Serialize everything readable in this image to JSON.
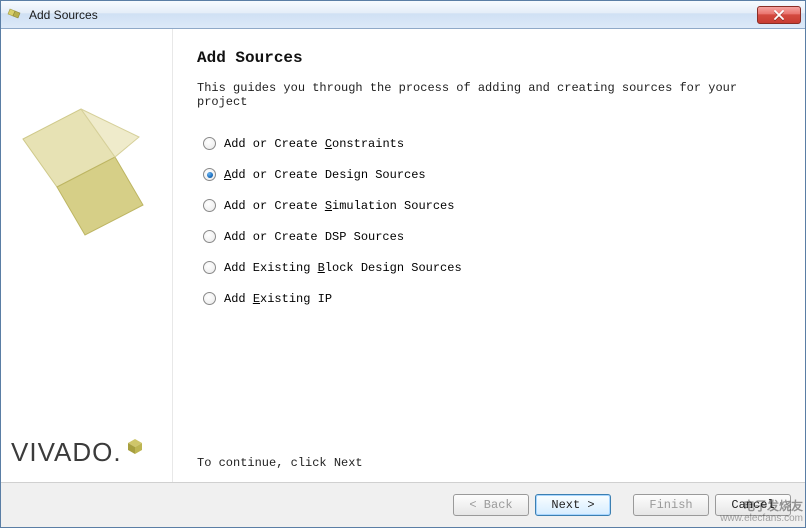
{
  "window": {
    "title": "Add Sources"
  },
  "main": {
    "heading": "Add Sources",
    "description": "This guides you through the process of adding and creating sources for your project",
    "options": [
      {
        "label": "Add or Create Constraints",
        "accel_index": 14,
        "selected": false
      },
      {
        "label": "Add or Create Design Sources",
        "accel_index": 0,
        "selected": true
      },
      {
        "label": "Add or Create Simulation Sources",
        "accel_index": 14,
        "selected": false
      },
      {
        "label": "Add or Create DSP Sources",
        "accel_index": -1,
        "selected": false
      },
      {
        "label": "Add Existing Block Design Sources",
        "accel_index": 13,
        "selected": false
      },
      {
        "label": "Add Existing IP",
        "accel_index": 4,
        "selected": false
      }
    ],
    "hint": "To continue, click Next"
  },
  "sidebar": {
    "brand": "VIVADO."
  },
  "buttons": {
    "back": "< Back",
    "next": "Next >",
    "finish": "Finish",
    "cancel": "Cancel",
    "back_enabled": false,
    "finish_enabled": false
  },
  "watermark": {
    "line1": "电子发烧友",
    "line2": "www.elecfans.com"
  }
}
